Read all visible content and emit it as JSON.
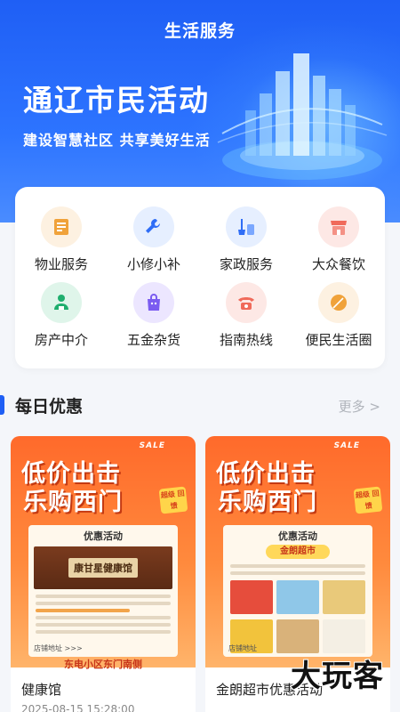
{
  "header": {
    "nav_title": "生活服务",
    "hero_title": "通辽市民活动",
    "hero_subtitle": "建设智慧社区 共享美好生活"
  },
  "services": [
    {
      "label": "物业服务",
      "icon": "document-icon",
      "color": "#f0a23a"
    },
    {
      "label": "小修小补",
      "icon": "wrench-icon",
      "color": "#2f6df6"
    },
    {
      "label": "家政服务",
      "icon": "cleaning-icon",
      "color": "#2f6df6"
    },
    {
      "label": "大众餐饮",
      "icon": "shop-icon",
      "color": "#f06a5a"
    },
    {
      "label": "房产中介",
      "icon": "house-agent-icon",
      "color": "#1fae6e"
    },
    {
      "label": "五金杂货",
      "icon": "shopping-bag-icon",
      "color": "#7b5cf0"
    },
    {
      "label": "指南热线",
      "icon": "phone-icon",
      "color": "#f06a5a"
    },
    {
      "label": "便民生活圈",
      "icon": "leaf-icon",
      "color": "#f0a23a"
    }
  ],
  "deals": {
    "title": "每日优惠",
    "more_label": "更多 >",
    "cards": [
      {
        "sale_tag": "SALE",
        "poster_line1": "低价出击",
        "poster_line2": "乐购西门",
        "badge": "超级 回馈",
        "notice_title": "优惠活动",
        "store_sign": "康甘星健康馆",
        "addr_label": "店铺地址 >>>",
        "footer": "东电小区东门南侧",
        "name": "健康馆",
        "time": "2025-08-15 15:28:00"
      },
      {
        "sale_tag": "SALE",
        "poster_line1": "低价出击",
        "poster_line2": "乐购西门",
        "badge": "超级 回馈",
        "notice_title": "优惠活动",
        "market_banner": "金朗超市",
        "addr_label": "店铺地址",
        "name": "金朗超市优惠活动"
      }
    ]
  },
  "watermark": "大玩客"
}
